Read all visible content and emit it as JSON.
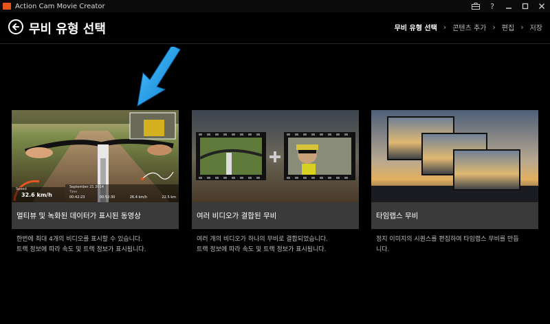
{
  "app": {
    "title": "Action Cam Movie Creator"
  },
  "window_controls": [
    {
      "name": "toolbox-icon",
      "glyph": "⊞"
    },
    {
      "name": "help-icon",
      "glyph": "?"
    },
    {
      "name": "minimize-icon",
      "glyph": "—"
    },
    {
      "name": "maximize-icon",
      "glyph": "□"
    },
    {
      "name": "close-icon",
      "glyph": "✕"
    }
  ],
  "header": {
    "title": "무비 유형 선택",
    "breadcrumb": [
      "무비 유형 선택",
      "콘텐츠 추가",
      "편집",
      "저장"
    ]
  },
  "cards": [
    {
      "label": "멀티뷰 및 녹화된 데이터가 표시된 동영상",
      "desc": [
        "한번에 최대 4개의 비디오를 표시할 수 있습니다.",
        "트랙 정보에 따라 속도 및 트랙 정보가 표시됩니다."
      ],
      "overlay": {
        "speed_label": "Speed",
        "speed_value": "32.6 km/h",
        "date": "September 21 2014",
        "time_label": "Time",
        "stats": [
          "00:42:23",
          "00:52:30",
          "26.4 km/h",
          "22.5 km"
        ]
      }
    },
    {
      "label": "여러 비디오가 결합된 무비",
      "desc": [
        "여러 개의 비디오가 하나의 무비로 결합되었습니다.",
        "트랙 정보에 따라 속도 및 트랙 정보가 표시됩니다."
      ]
    },
    {
      "label": "타임랩스 무비",
      "desc": [
        "정지 이미지의 시퀀스를 편집하여 타임랩스 무비를 만듭",
        "니다."
      ]
    }
  ],
  "colors": {
    "accent": "#e8551c",
    "arrow": "#1f9ce8",
    "label_bar": "#3a3a3a"
  }
}
